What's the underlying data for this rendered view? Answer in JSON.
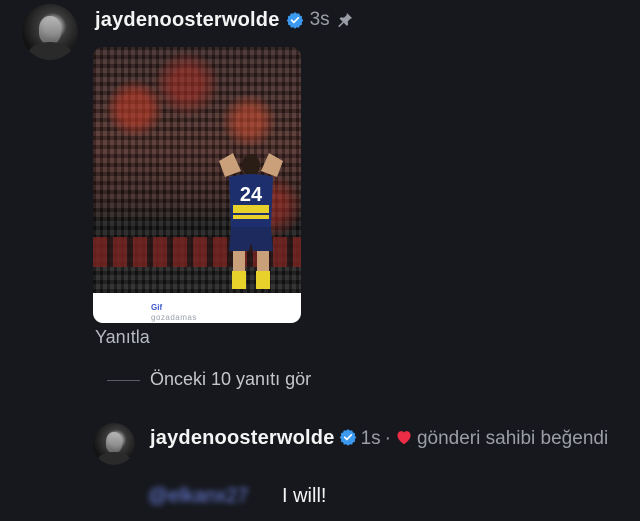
{
  "comment": {
    "username": "jaydenoosterwolde",
    "time": "3s",
    "gif": {
      "label": "Gif",
      "sublabel": "gozadamas",
      "jersey_number": "24"
    },
    "reply_label": "Yanıtla"
  },
  "thread": {
    "view_previous": "Önceki 10 yanıtı gör"
  },
  "reply": {
    "username": "jaydenoosterwolde",
    "time": "1s",
    "separator": "·",
    "liked_by_owner": "gönderi sahibi beğendi",
    "mention": "@elkanx27",
    "text": "I will!"
  },
  "colors": {
    "background": "#16181d",
    "verified": "#3b9af0",
    "heart": "#ed2d45",
    "mention": "#6f84e6"
  },
  "icons": [
    "verified-icon",
    "pin-icon",
    "heart-icon"
  ]
}
